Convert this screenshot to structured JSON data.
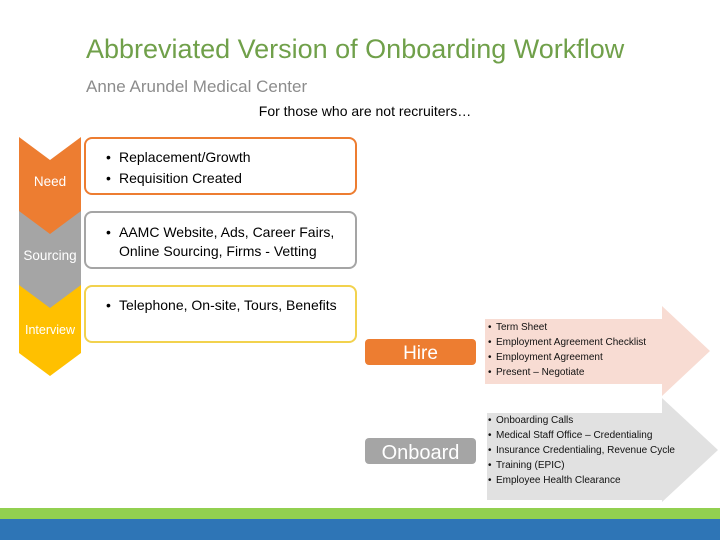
{
  "header": {
    "title": "Abbreviated Version of Onboarding Workflow",
    "subtitle": "Anne Arundel Medical Center",
    "note": "For those who are not recruiters…"
  },
  "stages": [
    {
      "label": "Need",
      "color": "#ed7d31",
      "items": [
        "Replacement/Growth",
        "Requisition Created"
      ]
    },
    {
      "label": "Sourcing",
      "color": "#a5a5a5",
      "items": [
        "AAMC Website, Ads, Career Fairs, Online Sourcing, Firms - Vetting"
      ]
    },
    {
      "label": "Interview",
      "color": "#ffc000",
      "items": [
        "Telephone, On-site, Tours, Benefits"
      ]
    }
  ],
  "steps": [
    {
      "label": "Hire",
      "color": "#ed7d31",
      "arrow_color": "#f8dcd3",
      "items": [
        "Term Sheet",
        "Employment Agreement Checklist",
        "Employment Agreement",
        "Present – Negotiate"
      ]
    },
    {
      "label": "Onboard",
      "color": "#a5a5a5",
      "arrow_color": "#e1e1e1",
      "items": [
        "Onboarding Calls",
        "Medical Staff Office – Credentialing",
        "Insurance Credentialing, Revenue Cycle",
        "Training (EPIC)",
        "Employee Health Clearance"
      ]
    }
  ],
  "footer": {
    "green": "#92d050",
    "blue": "#2e75b6"
  }
}
